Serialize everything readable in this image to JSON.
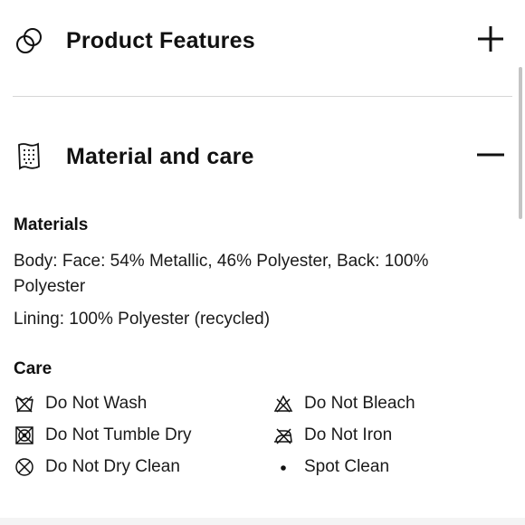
{
  "sections": [
    {
      "title": "Product Features",
      "icon": "overlapping-circles-icon",
      "state_icon": "plus-icon"
    },
    {
      "title": "Material and care",
      "icon": "fabric-swatch-icon",
      "state_icon": "minus-icon"
    }
  ],
  "materials": {
    "heading": "Materials",
    "body": "Body: Face: 54% Metallic, 46% Polyester, Back: 100% Polyester",
    "lining": "Lining: 100% Polyester (recycled)"
  },
  "care": {
    "heading": "Care",
    "items": [
      {
        "label": "Do Not Wash",
        "icon": "do-not-wash-icon"
      },
      {
        "label": "Do Not Bleach",
        "icon": "do-not-bleach-icon"
      },
      {
        "label": "Do Not Tumble Dry",
        "icon": "do-not-tumble-dry-icon"
      },
      {
        "label": "Do Not Iron",
        "icon": "do-not-iron-icon"
      },
      {
        "label": "Do Not Dry Clean",
        "icon": "do-not-dry-clean-icon"
      },
      {
        "label": "Spot Clean",
        "icon": "bullet-icon"
      }
    ]
  }
}
